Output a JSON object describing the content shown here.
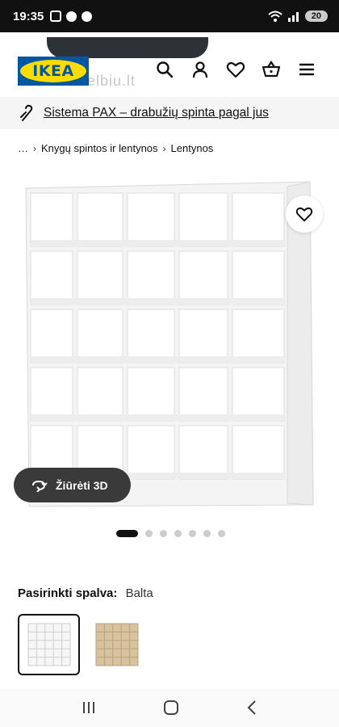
{
  "status_bar": {
    "time": "19:35",
    "battery": "20",
    "icons": [
      "screenshot-icon",
      "facebook-icon",
      "messenger-icon",
      "wifi-icon",
      "signal-icon",
      "battery-icon"
    ]
  },
  "header": {
    "watermark": "skelbiu.lt",
    "logo_text": "IKEA",
    "icons": [
      "search-icon",
      "user-icon",
      "heart-icon",
      "cart-icon",
      "menu-icon"
    ]
  },
  "promo": {
    "text": "Sistema PAX – drabužių spinta pagal jus"
  },
  "breadcrumb": {
    "items": [
      "…",
      "Knygų spintos ir lentynos",
      "Lentynos"
    ]
  },
  "product": {
    "view_3d_label": "Žiūrėti 3D",
    "image_count": 7,
    "active_image": 1,
    "color_label": "Pasirinkti spalva:",
    "color_value": "Balta",
    "colors": {
      "white": "#ffffff",
      "oak": "#d8c3a0",
      "brand_blue": "#0058a3",
      "brand_yellow": "#ffdb00"
    }
  }
}
